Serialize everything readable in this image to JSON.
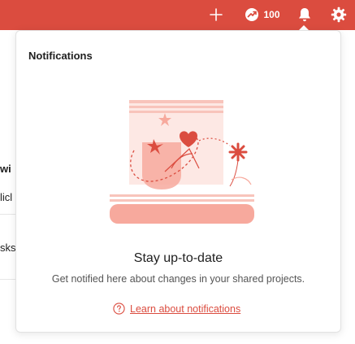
{
  "topbar": {
    "karma_count": "100",
    "add_icon": "plus-icon",
    "karma_icon": "karma-icon",
    "notifications_icon": "bell-icon",
    "settings_icon": "gear-icon",
    "bar_color": "#db4c3f"
  },
  "background": {
    "fragments": [
      "wi",
      "licl",
      "sks"
    ]
  },
  "notifications": {
    "title": "Notifications",
    "empty_title": "Stay up-to-date",
    "empty_description": "Get notified here about changes in your shared projects.",
    "learn_link": "Learn about notifications",
    "help_icon": "question-circle-icon",
    "accent_color": "#db4c3f"
  }
}
